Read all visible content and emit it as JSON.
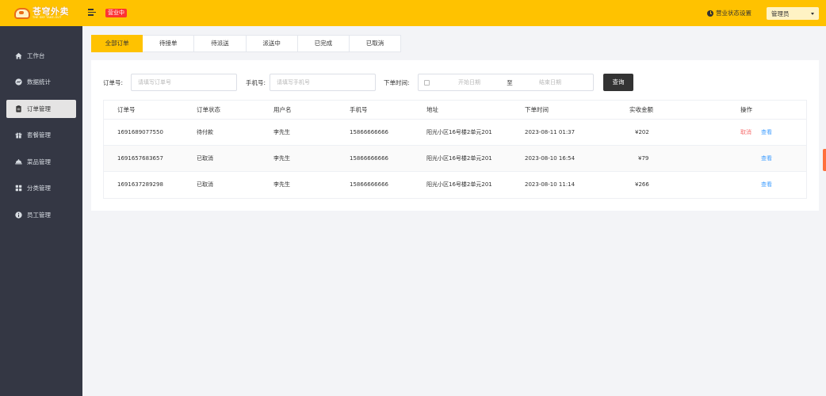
{
  "app": {
    "logo_cn": "苍穹外卖",
    "logo_en": "THE SKY TAKE-OUT",
    "status_badge": "营业中",
    "shop_status_setting": "营业状态设置",
    "admin_name": "管理员"
  },
  "sidebar": {
    "items": [
      {
        "label": "工作台",
        "icon": "home-icon",
        "active": false
      },
      {
        "label": "数据统计",
        "icon": "chart-icon",
        "active": false
      },
      {
        "label": "订单管理",
        "icon": "clipboard-icon",
        "active": true
      },
      {
        "label": "套餐管理",
        "icon": "gift-icon",
        "active": false
      },
      {
        "label": "菜品管理",
        "icon": "dish-icon",
        "active": false
      },
      {
        "label": "分类管理",
        "icon": "grid-icon",
        "active": false
      },
      {
        "label": "员工管理",
        "icon": "info-icon",
        "active": false
      }
    ]
  },
  "tabs": [
    {
      "label": "全部订单",
      "active": true
    },
    {
      "label": "待接单",
      "active": false
    },
    {
      "label": "待派送",
      "active": false
    },
    {
      "label": "派送中",
      "active": false
    },
    {
      "label": "已完成",
      "active": false
    },
    {
      "label": "已取消",
      "active": false
    }
  ],
  "filters": {
    "order_no_label": "订单号:",
    "order_no_placeholder": "请填写订单号",
    "phone_label": "手机号:",
    "phone_placeholder": "请填写手机号",
    "time_label": "下单时间:",
    "start_placeholder": "开始日期",
    "range_separator": "至",
    "end_placeholder": "结束日期",
    "search_button": "查询"
  },
  "table": {
    "columns": [
      "订单号",
      "订单状态",
      "用户名",
      "手机号",
      "地址",
      "下单时间",
      "实收金额",
      "操作"
    ],
    "rows": [
      {
        "order_no": "1691689077550",
        "status": "待付款",
        "user": "李先生",
        "phone": "15866666666",
        "address": "阳光小区16号楼2单元201",
        "time": "2023-08-11 01:37",
        "amount": "¥202",
        "actions": [
          "取消",
          "查看"
        ]
      },
      {
        "order_no": "1691657683657",
        "status": "已取消",
        "user": "李先生",
        "phone": "15866666666",
        "address": "阳光小区16号楼2单元201",
        "time": "2023-08-10 16:54",
        "amount": "¥79",
        "actions": [
          "查看"
        ]
      },
      {
        "order_no": "1691637289298",
        "status": "已取消",
        "user": "李先生",
        "phone": "15866666666",
        "address": "阳光小区16号楼2单元201",
        "time": "2023-08-10 11:14",
        "amount": "¥266",
        "actions": [
          "查看"
        ]
      }
    ]
  },
  "colors": {
    "brand": "#ffc200",
    "sidebar": "#343744",
    "badge": "#fd3333",
    "cancel_link": "#f56c6c",
    "view_link": "#409eff"
  }
}
